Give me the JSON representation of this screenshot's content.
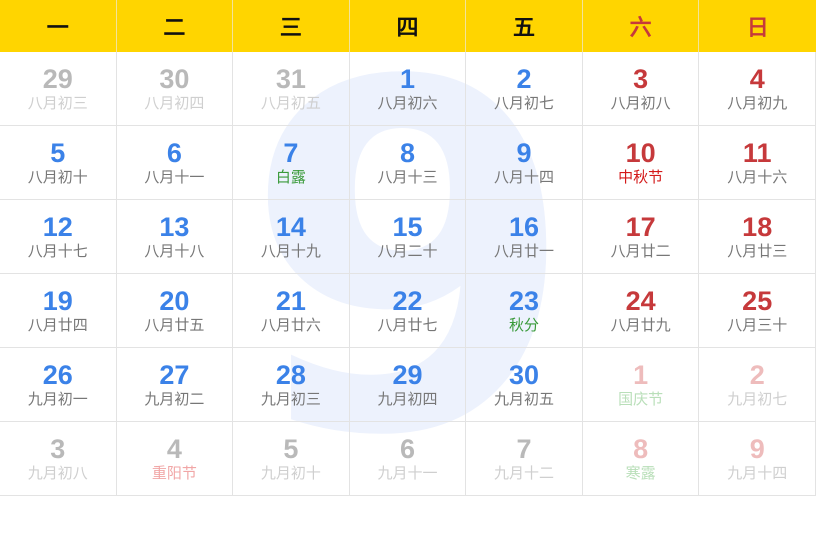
{
  "watermark": "9",
  "weekdays": [
    "一",
    "二",
    "三",
    "四",
    "五",
    "六",
    "日"
  ],
  "days": [
    {
      "day": "29",
      "sub": "八月初三"
    },
    {
      "day": "30",
      "sub": "八月初四"
    },
    {
      "day": "31",
      "sub": "八月初五"
    },
    {
      "day": "1",
      "sub": "八月初六"
    },
    {
      "day": "2",
      "sub": "八月初七"
    },
    {
      "day": "3",
      "sub": "八月初八"
    },
    {
      "day": "4",
      "sub": "八月初九"
    },
    {
      "day": "5",
      "sub": "八月初十"
    },
    {
      "day": "6",
      "sub": "八月十一"
    },
    {
      "day": "7",
      "sub": "白露"
    },
    {
      "day": "8",
      "sub": "八月十三"
    },
    {
      "day": "9",
      "sub": "八月十四"
    },
    {
      "day": "10",
      "sub": "中秋节"
    },
    {
      "day": "11",
      "sub": "八月十六"
    },
    {
      "day": "12",
      "sub": "八月十七"
    },
    {
      "day": "13",
      "sub": "八月十八"
    },
    {
      "day": "14",
      "sub": "八月十九"
    },
    {
      "day": "15",
      "sub": "八月二十"
    },
    {
      "day": "16",
      "sub": "八月廿一"
    },
    {
      "day": "17",
      "sub": "八月廿二"
    },
    {
      "day": "18",
      "sub": "八月廿三"
    },
    {
      "day": "19",
      "sub": "八月廿四"
    },
    {
      "day": "20",
      "sub": "八月廿五"
    },
    {
      "day": "21",
      "sub": "八月廿六"
    },
    {
      "day": "22",
      "sub": "八月廿七"
    },
    {
      "day": "23",
      "sub": "秋分"
    },
    {
      "day": "24",
      "sub": "八月廿九"
    },
    {
      "day": "25",
      "sub": "八月三十"
    },
    {
      "day": "26",
      "sub": "九月初一"
    },
    {
      "day": "27",
      "sub": "九月初二"
    },
    {
      "day": "28",
      "sub": "九月初三"
    },
    {
      "day": "29",
      "sub": "九月初四"
    },
    {
      "day": "30",
      "sub": "九月初五"
    },
    {
      "day": "1",
      "sub": "国庆节"
    },
    {
      "day": "2",
      "sub": "九月初七"
    },
    {
      "day": "3",
      "sub": "九月初八"
    },
    {
      "day": "4",
      "sub": "重阳节"
    },
    {
      "day": "5",
      "sub": "九月初十"
    },
    {
      "day": "6",
      "sub": "九月十一"
    },
    {
      "day": "7",
      "sub": "九月十二"
    },
    {
      "day": "8",
      "sub": "寒露"
    },
    {
      "day": "9",
      "sub": "九月十四"
    }
  ]
}
